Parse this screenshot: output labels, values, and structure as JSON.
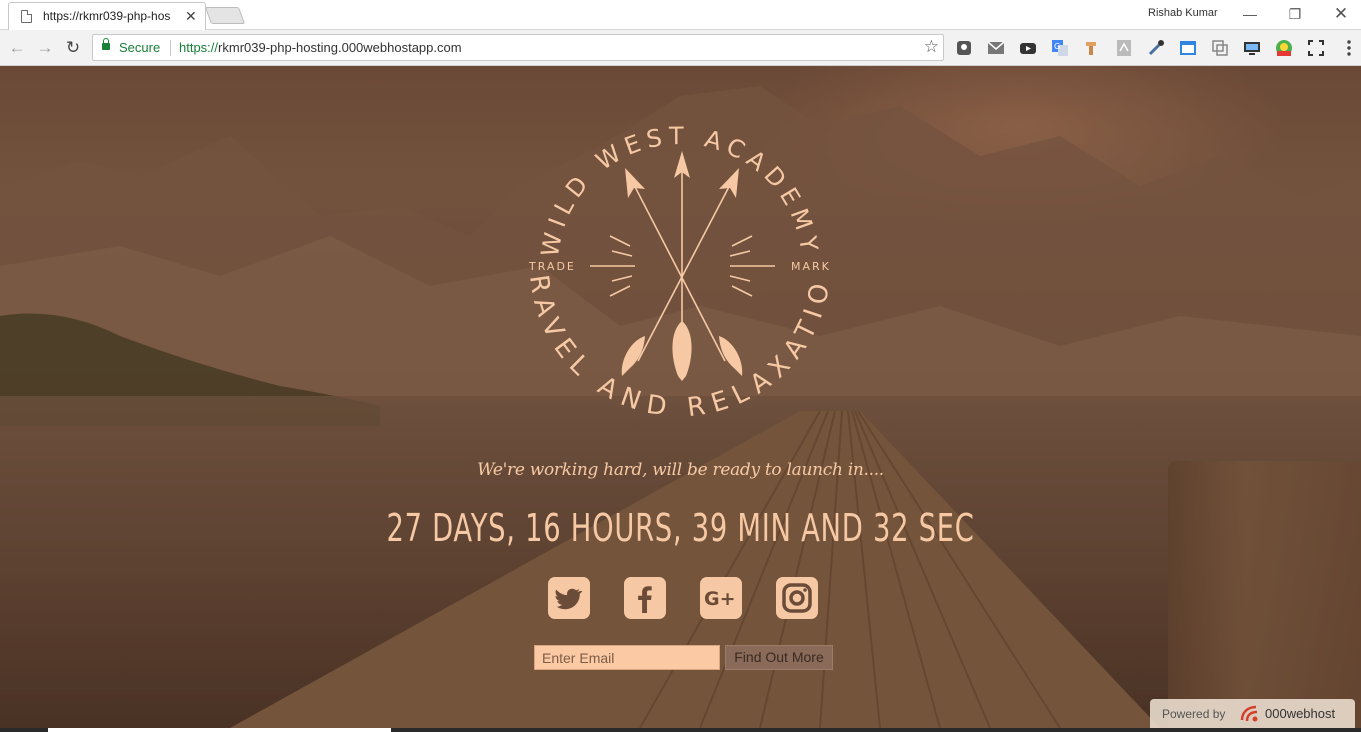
{
  "browser": {
    "tab_title": "https://rkmr039-php-hos",
    "profile_name": "Rishab Kumar",
    "secure_label": "Secure",
    "url_scheme": "https://",
    "url_host": "rkmr039-php-hosting.000webhostapp.com",
    "extensions": [
      "lastpass-icon",
      "gmail-checker-icon",
      "youtube-icon",
      "google-translate-icon",
      "paint-icon",
      "pdf-icon",
      "eyedropper-icon",
      "window-resizer-icon",
      "tab-duplicator-icon",
      "screen-cast-icon",
      "chrome-remote-icon",
      "fullscreen-icon",
      "menu-icon"
    ]
  },
  "logo": {
    "top_arc": "WILD WEST ACADEMY",
    "bottom_arc": "TRAVEL AND RELAXATION",
    "left_mark": "TRADE",
    "right_mark": "MARK"
  },
  "hero": {
    "tagline": "We're working hard, will be ready to launch in....",
    "countdown": "27 DAYS, 16 HOURS, 39 MIN AND 32 SEC"
  },
  "social": [
    "twitter-icon",
    "facebook-icon",
    "google-plus-icon",
    "instagram-icon"
  ],
  "form": {
    "email_placeholder": "Enter Email",
    "submit_label": "Find Out More"
  },
  "footer": {
    "powered_by": "Powered by",
    "brand": "000webhost"
  },
  "colors": {
    "accent": "#f6c9a4",
    "secure_green": "#188038"
  }
}
